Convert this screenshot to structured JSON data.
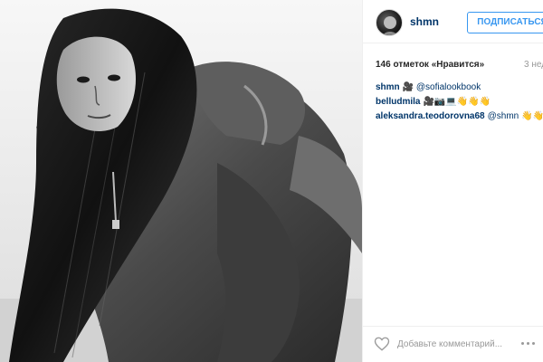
{
  "post": {
    "username": "shmn",
    "follow_label": "ПОДПИСАТЬСЯ",
    "likes_text": "146 отметок «Нравится»",
    "time_text": "3 нед"
  },
  "comments": [
    {
      "user": "shmn",
      "emoji_before": "🎥",
      "mention": "@sofialookbook",
      "emoji_after": ""
    },
    {
      "user": "belludmila",
      "emoji_before": "🎥📷💻👋👋👋",
      "mention": "",
      "emoji_after": ""
    },
    {
      "user": "aleksandra.teodorovna68",
      "emoji_before": "",
      "mention": "@shmn",
      "emoji_after": "👋👋☺"
    }
  ],
  "add_comment": {
    "placeholder": "Добавьте комментарий..."
  },
  "icons": {
    "like": "heart-outline-icon",
    "more": "more-options-icon"
  },
  "colors": {
    "follow": "#3897f0",
    "username": "#003569",
    "muted": "#999999"
  }
}
